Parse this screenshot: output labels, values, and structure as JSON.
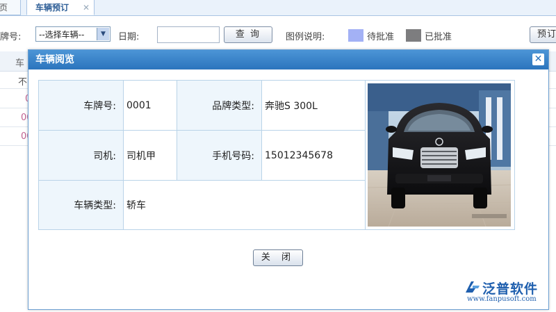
{
  "tabs": [
    {
      "label": "页"
    },
    {
      "label": "车辆预订",
      "close": "✕"
    }
  ],
  "toolbar": {
    "plate_label": "牌号:",
    "vehicle_select": "--选择车辆--",
    "date_label": "日期:",
    "date_value": "",
    "query_button": "查 询",
    "legend_label": "图例说明:",
    "legend_pending": "待批准",
    "legend_approved": "已批准",
    "book_button": "预订"
  },
  "colors": {
    "pending": "#a3b1f5",
    "approved": "#7d7d7f",
    "title_bar": "#2b74bd"
  },
  "background_grid": {
    "header": "车",
    "rows": [
      "不",
      "0",
      "00",
      "00"
    ]
  },
  "modal": {
    "title": "车辆阅览",
    "close_icon": "✕",
    "fields": {
      "plate_label": "车牌号:",
      "plate_value": "0001",
      "brand_label": "品牌类型:",
      "brand_value": "奔驰S 300L",
      "driver_label": "司机:",
      "driver_value": "司机甲",
      "phone_label": "手机号码:",
      "phone_value": "15012345678",
      "type_label": "车辆类型:",
      "type_value": "轿车"
    },
    "close_button": "关 闭"
  },
  "watermark": {
    "name": "泛普软件",
    "url": "www.fanpusoft.com"
  }
}
